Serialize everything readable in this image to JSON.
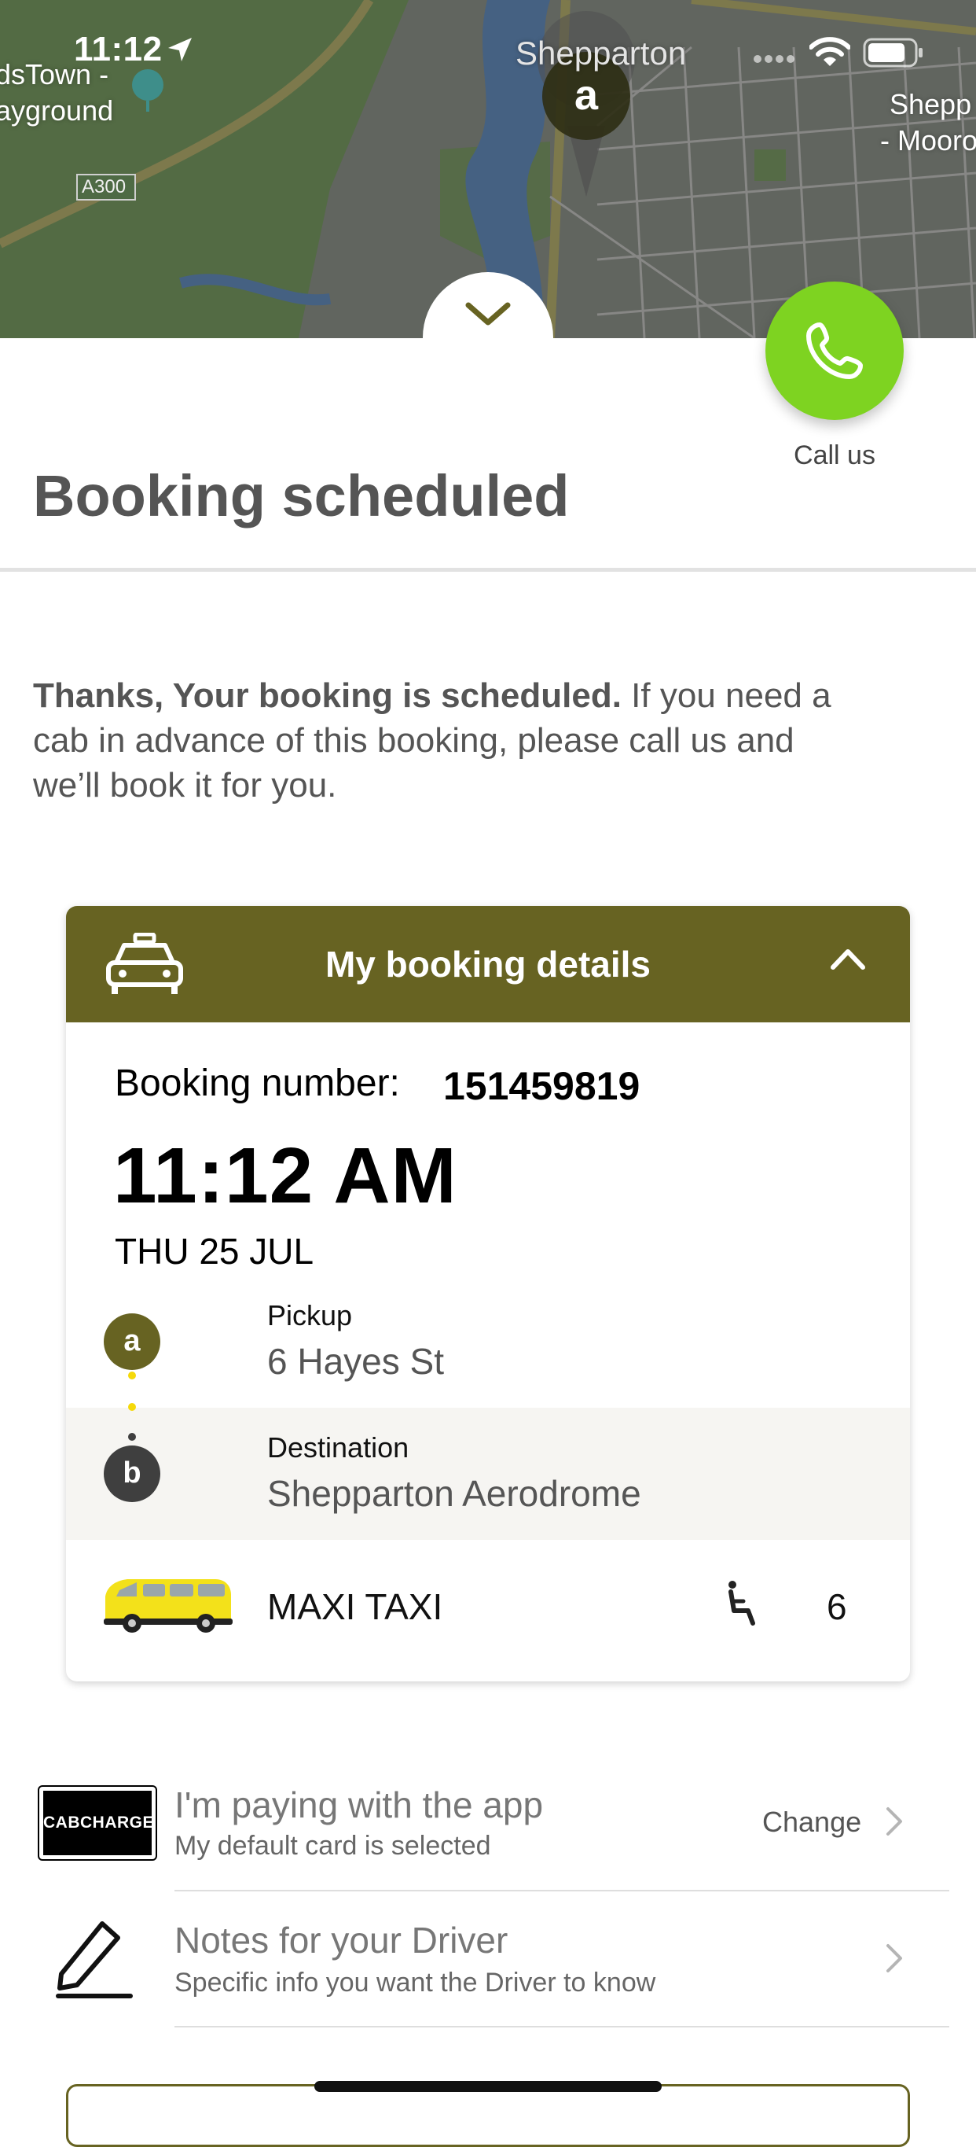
{
  "status_bar": {
    "time": "11:12"
  },
  "map": {
    "labels": [
      "dsTown -",
      "ayground",
      "A300",
      "Shepparton",
      "Shepp",
      "- Mooro"
    ],
    "pin_letter": "a"
  },
  "call": {
    "label": "Call us"
  },
  "page": {
    "title": "Booking scheduled"
  },
  "intro": {
    "bold": "Thanks, Your booking is scheduled.",
    "rest": " If you need a cab in advance of this booking, please call us and we’ll book it for you."
  },
  "booking_card": {
    "header_title": "My booking details",
    "booking_number_label": "Booking number:",
    "booking_number": "151459819",
    "time": "11:12 AM",
    "date": "THU 25 JUL",
    "pickup": {
      "letter": "a",
      "label": "Pickup",
      "address": "6 Hayes St"
    },
    "destination": {
      "letter": "b",
      "label": "Destination",
      "address": "Shepparton Aerodrome"
    },
    "vehicle": {
      "name": "MAXI TAXI",
      "seats": "6"
    }
  },
  "payment": {
    "logo_text": "CABCHARGE",
    "title": "I'm paying with the app",
    "subtitle": "My default card is selected",
    "change_label": "Change"
  },
  "notes": {
    "title": "Notes for your Driver",
    "subtitle": "Specific info you want the Driver to know"
  },
  "colors": {
    "accent": "#676322",
    "call_green": "#7ed321",
    "taxi_yellow": "#f3e11a"
  }
}
